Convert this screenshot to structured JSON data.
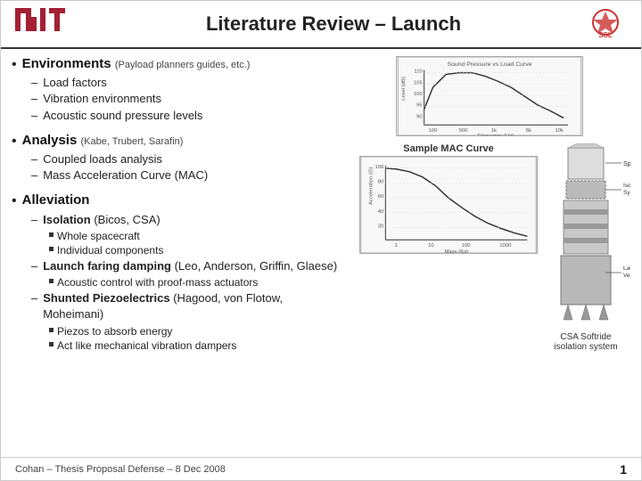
{
  "header": {
    "mit_logo": "MIT",
    "title": "Literature Review – Launch",
    "ssl_logo": "SSL"
  },
  "sections": [
    {
      "id": "environments",
      "bullet": "•",
      "title": "Environments",
      "subtitle": "(Payload planners guides, etc.)",
      "items": [
        {
          "text": "Load factors"
        },
        {
          "text": "Vibration environments"
        },
        {
          "text": "Acoustic sound pressure levels"
        }
      ]
    },
    {
      "id": "analysis",
      "bullet": "•",
      "title": "Analysis",
      "subtitle": "(Kabe, Trubert, Sarafin)",
      "items": [
        {
          "text": "Coupled loads analysis"
        },
        {
          "text": "Mass Acceleration Curve (MAC)"
        }
      ]
    },
    {
      "id": "alleviation",
      "bullet": "•",
      "title": "Alleviation",
      "subtitle": "",
      "items": [
        {
          "text": "Isolation",
          "small": "(Bicos, CSA)",
          "subitems": [
            {
              "text": "Whole spacecraft"
            },
            {
              "text": "Individual components"
            }
          ]
        },
        {
          "text": "Launch faring damping",
          "small": "(Leo, Anderson, Griffin, Glaese)",
          "subitems": [
            {
              "text": "Acoustic control with proof-mass actuators"
            }
          ]
        },
        {
          "text": "Shunted Piezoelectrics",
          "small": "(Hagood, von Flotow, Moheimani)",
          "subitems": [
            {
              "text": "Piezos to absorb energy"
            },
            {
              "text": "Act like mechanical vibration dampers"
            }
          ]
        }
      ]
    }
  ],
  "charts": {
    "top_label": "Sound Pressure Load Curve",
    "mac_label": "Sample MAC Curve"
  },
  "labels": {
    "spacecraft": "Spacecraft",
    "isolation_system": "Isolation\nSystem",
    "launch_vehicle": "Launch\nVehicle"
  },
  "footer": {
    "citation": "Cohan – Thesis Proposal Defense – 8 Dec 2008",
    "page": "1"
  },
  "csa_note": "CSA Softride\nisolation system"
}
